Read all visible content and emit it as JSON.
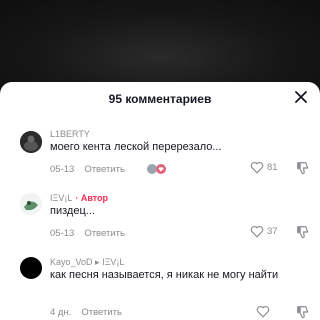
{
  "header": {
    "title": "95 комментариев"
  },
  "comments": [
    {
      "username": "L1BERTY",
      "text": "моего кента леской перерезало...",
      "date": "05-13",
      "reply_label": "Ответить",
      "likes": "81",
      "is_author": false
    },
    {
      "username": "ΙΞV¡L",
      "author_badge": "· Автор",
      "text": "пиздец...",
      "date": "05-13",
      "reply_label": "Ответить",
      "likes": "37",
      "is_author": true
    },
    {
      "username": "Kayo_VoD",
      "username_suffix": "▸ ΙΞV¡L",
      "text": "как песня называется, я никак не могу найти",
      "date": "4 дн.",
      "reply_label": "Ответить",
      "likes": "",
      "is_author": false
    }
  ],
  "icons": [
    "close-icon",
    "heart-icon",
    "dislike-icon"
  ],
  "colors": {
    "accent": "#fe2c55",
    "text": "#161823",
    "muted": "#8a8b91"
  }
}
